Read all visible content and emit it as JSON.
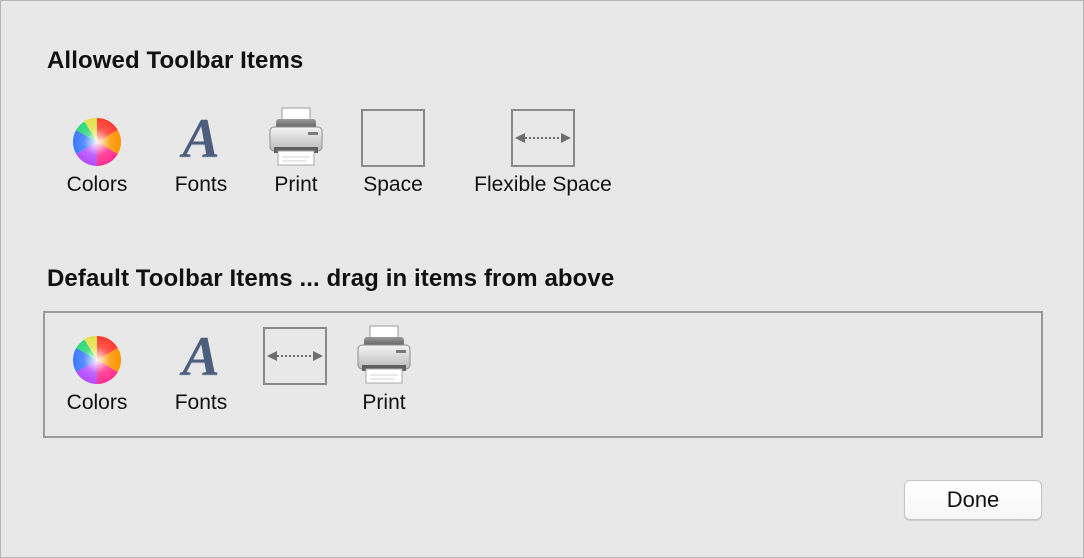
{
  "allowed": {
    "title": "Allowed Toolbar Items",
    "items": [
      {
        "label": "Colors",
        "icon": "color-wheel-icon"
      },
      {
        "label": "Fonts",
        "icon": "fonts-icon",
        "glyph": "A"
      },
      {
        "label": "Print",
        "icon": "printer-icon"
      },
      {
        "label": "Space",
        "icon": "space-box-icon"
      },
      {
        "label": "Flexible Space",
        "icon": "flexible-space-icon"
      }
    ]
  },
  "default": {
    "title": "Default Toolbar Items ... drag in items from above",
    "items": [
      {
        "label": "Colors",
        "icon": "color-wheel-icon"
      },
      {
        "label": "Fonts",
        "icon": "fonts-icon",
        "glyph": "A"
      },
      {
        "label": "",
        "icon": "flexible-space-icon"
      },
      {
        "label": "Print",
        "icon": "printer-icon"
      }
    ]
  },
  "done_label": "Done",
  "colors": {
    "background": "#e8e8e8",
    "border": "#9a9a9a",
    "fonts_glyph": "#4c5e7c"
  }
}
